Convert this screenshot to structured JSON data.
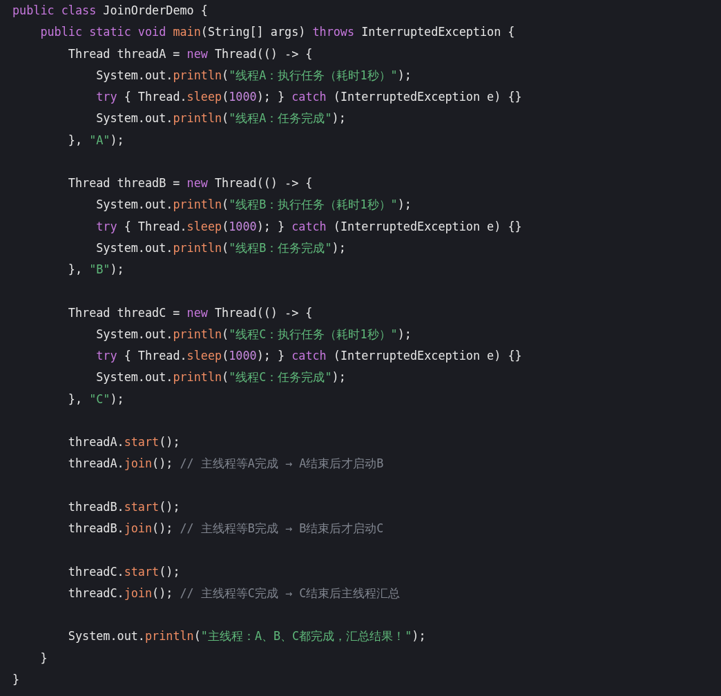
{
  "code_blocks": [
    [
      {
        "tokens": [
          {
            "kind": "keyword",
            "text": "public class"
          },
          {
            "kind": "plain",
            "text": " JoinOrderDemo {"
          }
        ]
      },
      {
        "tokens": [
          {
            "kind": "keyword",
            "text": "    public static void "
          },
          {
            "kind": "method",
            "text": "main"
          },
          {
            "kind": "plain",
            "text": "(String[] args) "
          },
          {
            "kind": "keyword",
            "text": "throws"
          },
          {
            "kind": "plain",
            "text": " InterruptedException {"
          }
        ]
      },
      {
        "tokens": [
          {
            "kind": "plain",
            "text": "        Thread threadA = "
          },
          {
            "kind": "keyword",
            "text": "new"
          },
          {
            "kind": "plain",
            "text": " Thread(() -> {"
          }
        ]
      },
      {
        "tokens": [
          {
            "kind": "plain",
            "text": "            System.out."
          },
          {
            "kind": "method",
            "text": "println"
          },
          {
            "kind": "plain",
            "text": "("
          },
          {
            "kind": "string",
            "text": "\"线程A：执行任务（耗时1秒）\""
          },
          {
            "kind": "plain",
            "text": ");"
          }
        ]
      },
      {
        "tokens": [
          {
            "kind": "keyword",
            "text": "            try"
          },
          {
            "kind": "plain",
            "text": " { Thread."
          },
          {
            "kind": "method",
            "text": "sleep"
          },
          {
            "kind": "plain",
            "text": "("
          },
          {
            "kind": "number",
            "text": "1000"
          },
          {
            "kind": "plain",
            "text": "); } "
          },
          {
            "kind": "keyword",
            "text": "catch"
          },
          {
            "kind": "plain",
            "text": " (InterruptedException e) {}"
          }
        ]
      },
      {
        "tokens": [
          {
            "kind": "plain",
            "text": "            System.out."
          },
          {
            "kind": "method",
            "text": "println"
          },
          {
            "kind": "plain",
            "text": "("
          },
          {
            "kind": "string",
            "text": "\"线程A：任务完成\""
          },
          {
            "kind": "plain",
            "text": ");"
          }
        ]
      },
      {
        "tokens": [
          {
            "kind": "plain",
            "text": "        }, "
          },
          {
            "kind": "string",
            "text": "\"A\""
          },
          {
            "kind": "plain",
            "text": ");"
          }
        ]
      }
    ],
    [
      {
        "tokens": [
          {
            "kind": "plain",
            "text": "        Thread threadB = "
          },
          {
            "kind": "keyword",
            "text": "new"
          },
          {
            "kind": "plain",
            "text": " Thread(() -> {"
          }
        ]
      },
      {
        "tokens": [
          {
            "kind": "plain",
            "text": "            System.out."
          },
          {
            "kind": "method",
            "text": "println"
          },
          {
            "kind": "plain",
            "text": "("
          },
          {
            "kind": "string",
            "text": "\"线程B：执行任务（耗时1秒）\""
          },
          {
            "kind": "plain",
            "text": ");"
          }
        ]
      },
      {
        "tokens": [
          {
            "kind": "keyword",
            "text": "            try"
          },
          {
            "kind": "plain",
            "text": " { Thread."
          },
          {
            "kind": "method",
            "text": "sleep"
          },
          {
            "kind": "plain",
            "text": "("
          },
          {
            "kind": "number",
            "text": "1000"
          },
          {
            "kind": "plain",
            "text": "); } "
          },
          {
            "kind": "keyword",
            "text": "catch"
          },
          {
            "kind": "plain",
            "text": " (InterruptedException e) {}"
          }
        ]
      },
      {
        "tokens": [
          {
            "kind": "plain",
            "text": "            System.out."
          },
          {
            "kind": "method",
            "text": "println"
          },
          {
            "kind": "plain",
            "text": "("
          },
          {
            "kind": "string",
            "text": "\"线程B：任务完成\""
          },
          {
            "kind": "plain",
            "text": ");"
          }
        ]
      },
      {
        "tokens": [
          {
            "kind": "plain",
            "text": "        }, "
          },
          {
            "kind": "string",
            "text": "\"B\""
          },
          {
            "kind": "plain",
            "text": ");"
          }
        ]
      }
    ],
    [
      {
        "tokens": [
          {
            "kind": "plain",
            "text": "        Thread threadC = "
          },
          {
            "kind": "keyword",
            "text": "new"
          },
          {
            "kind": "plain",
            "text": " Thread(() -> {"
          }
        ]
      },
      {
        "tokens": [
          {
            "kind": "plain",
            "text": "            System.out."
          },
          {
            "kind": "method",
            "text": "println"
          },
          {
            "kind": "plain",
            "text": "("
          },
          {
            "kind": "string",
            "text": "\"线程C：执行任务（耗时1秒）\""
          },
          {
            "kind": "plain",
            "text": ");"
          }
        ]
      },
      {
        "tokens": [
          {
            "kind": "keyword",
            "text": "            try"
          },
          {
            "kind": "plain",
            "text": " { Thread."
          },
          {
            "kind": "method",
            "text": "sleep"
          },
          {
            "kind": "plain",
            "text": "("
          },
          {
            "kind": "number",
            "text": "1000"
          },
          {
            "kind": "plain",
            "text": "); } "
          },
          {
            "kind": "keyword",
            "text": "catch"
          },
          {
            "kind": "plain",
            "text": " (InterruptedException e) {}"
          }
        ]
      },
      {
        "tokens": [
          {
            "kind": "plain",
            "text": "            System.out."
          },
          {
            "kind": "method",
            "text": "println"
          },
          {
            "kind": "plain",
            "text": "("
          },
          {
            "kind": "string",
            "text": "\"线程C：任务完成\""
          },
          {
            "kind": "plain",
            "text": ");"
          }
        ]
      },
      {
        "tokens": [
          {
            "kind": "plain",
            "text": "        }, "
          },
          {
            "kind": "string",
            "text": "\"C\""
          },
          {
            "kind": "plain",
            "text": ");"
          }
        ]
      }
    ],
    [
      {
        "tokens": [
          {
            "kind": "plain",
            "text": "        threadA."
          },
          {
            "kind": "method",
            "text": "start"
          },
          {
            "kind": "plain",
            "text": "();"
          }
        ]
      },
      {
        "tokens": [
          {
            "kind": "plain",
            "text": "        threadA."
          },
          {
            "kind": "method",
            "text": "join"
          },
          {
            "kind": "plain",
            "text": "(); "
          },
          {
            "kind": "comment",
            "text": "// 主线程等A完成 → A结束后才启动B"
          }
        ]
      }
    ],
    [
      {
        "tokens": [
          {
            "kind": "plain",
            "text": "        threadB."
          },
          {
            "kind": "method",
            "text": "start"
          },
          {
            "kind": "plain",
            "text": "();"
          }
        ]
      },
      {
        "tokens": [
          {
            "kind": "plain",
            "text": "        threadB."
          },
          {
            "kind": "method",
            "text": "join"
          },
          {
            "kind": "plain",
            "text": "(); "
          },
          {
            "kind": "comment",
            "text": "// 主线程等B完成 → B结束后才启动C"
          }
        ]
      }
    ],
    [
      {
        "tokens": [
          {
            "kind": "plain",
            "text": "        threadC."
          },
          {
            "kind": "method",
            "text": "start"
          },
          {
            "kind": "plain",
            "text": "();"
          }
        ]
      },
      {
        "tokens": [
          {
            "kind": "plain",
            "text": "        threadC."
          },
          {
            "kind": "method",
            "text": "join"
          },
          {
            "kind": "plain",
            "text": "(); "
          },
          {
            "kind": "comment",
            "text": "// 主线程等C完成 → C结束后主线程汇总"
          }
        ]
      }
    ],
    [
      {
        "tokens": [
          {
            "kind": "plain",
            "text": "        System.out."
          },
          {
            "kind": "method",
            "text": "println"
          },
          {
            "kind": "plain",
            "text": "("
          },
          {
            "kind": "string",
            "text": "\"主线程：A、B、C都完成，汇总结果！\""
          },
          {
            "kind": "plain",
            "text": ");"
          }
        ]
      },
      {
        "tokens": [
          {
            "kind": "plain",
            "text": "    }"
          }
        ]
      },
      {
        "tokens": [
          {
            "kind": "plain",
            "text": "}"
          }
        ]
      }
    ]
  ]
}
